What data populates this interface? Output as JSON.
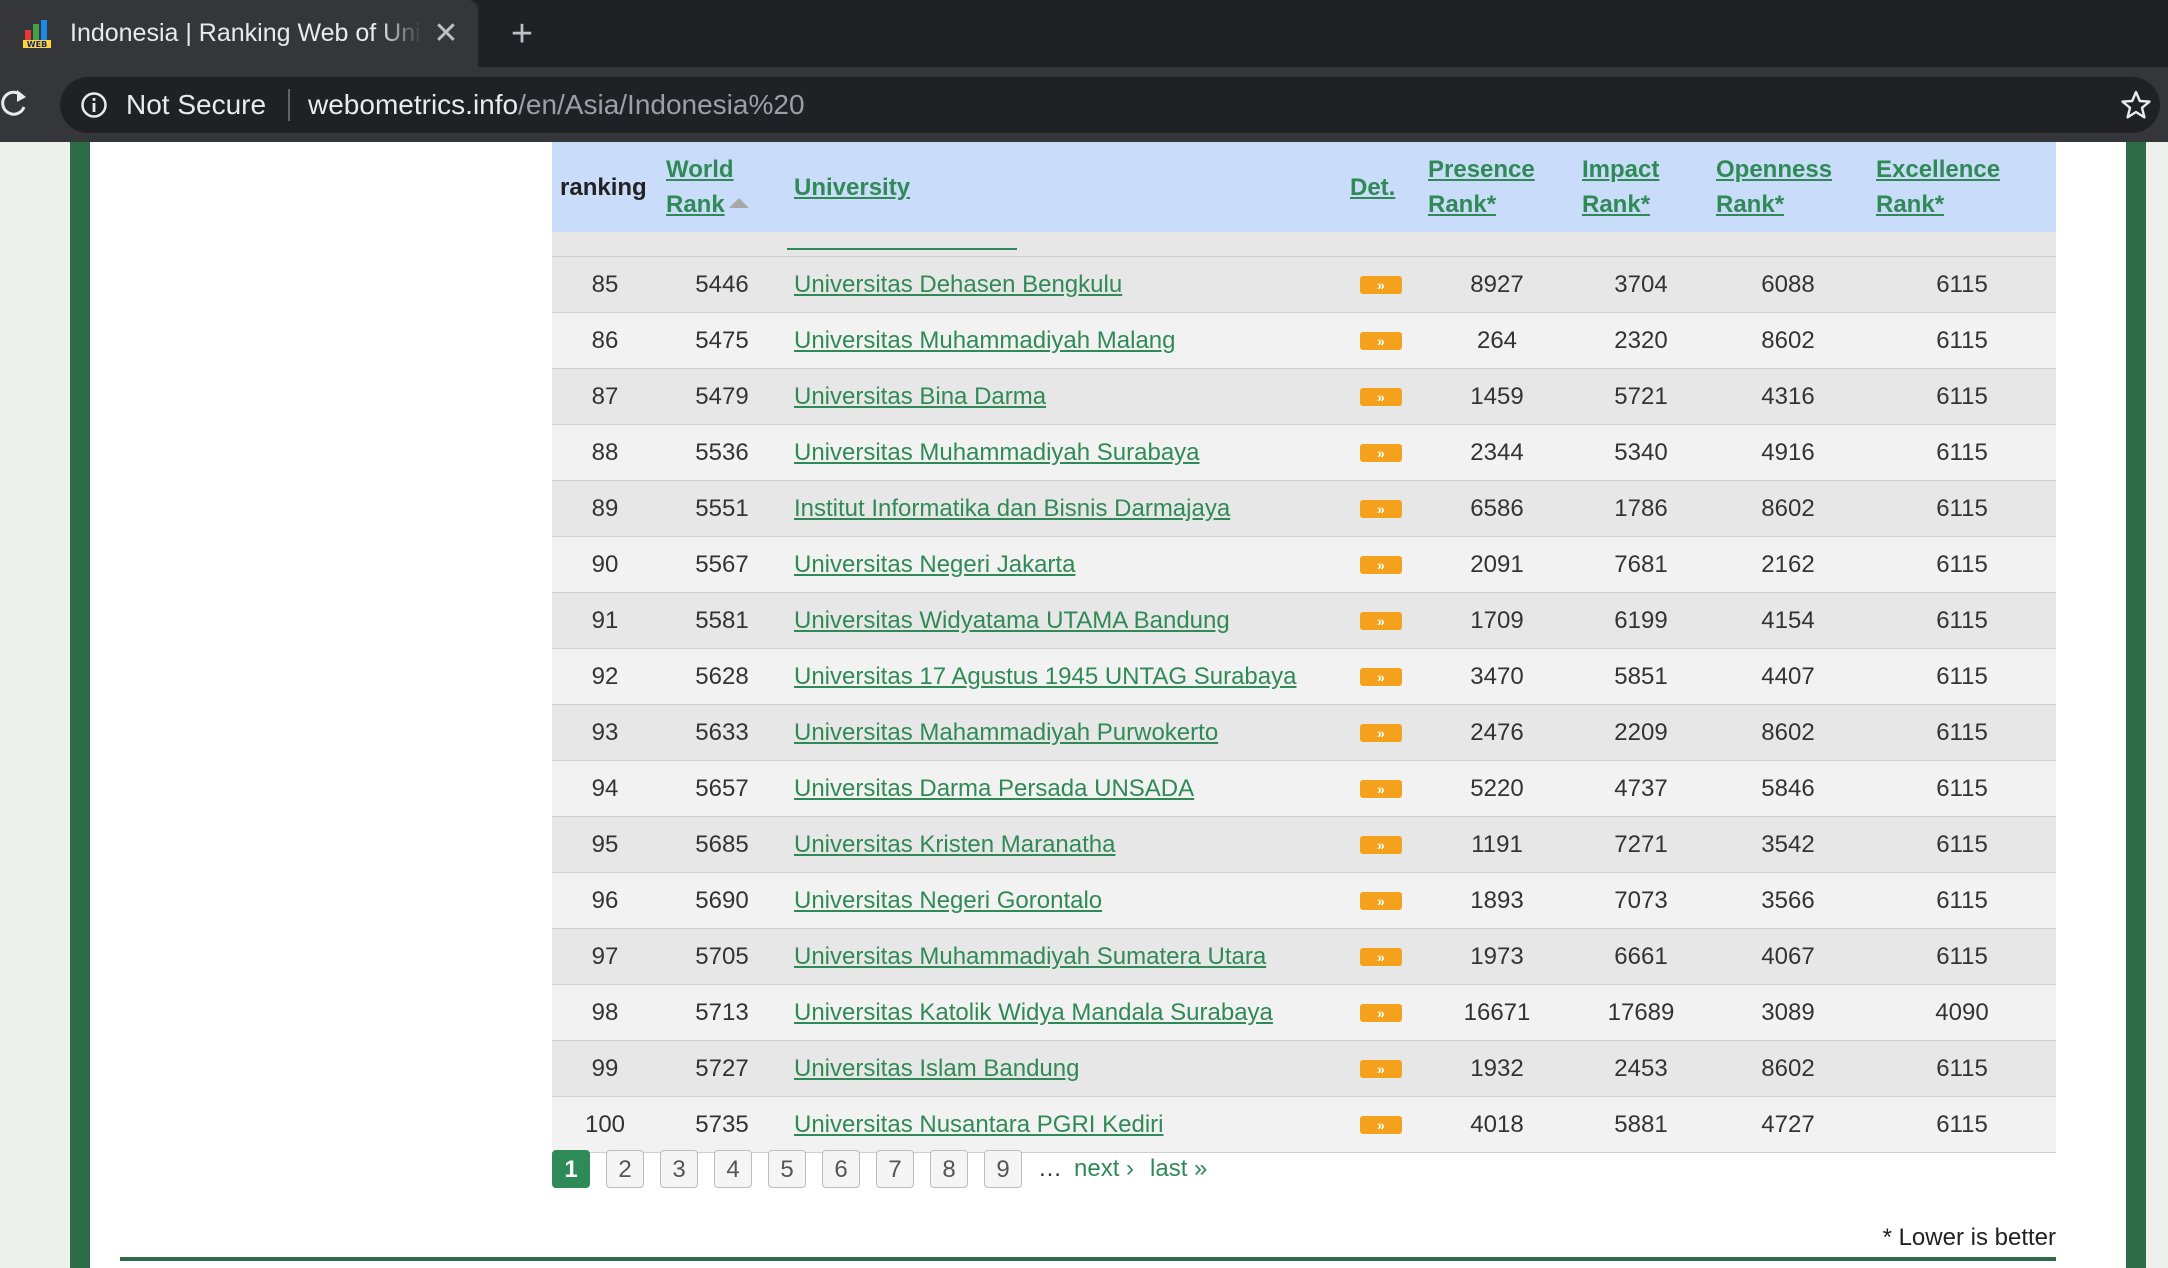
{
  "browser": {
    "tab_title": "Indonesia | Ranking Web of Universities",
    "close_glyph": "✕",
    "new_tab_glyph": "+",
    "security_label": "Not Secure",
    "url_host": "webometrics.info",
    "url_path": "/en/Asia/Indonesia%20"
  },
  "table": {
    "headers": {
      "ranking": "ranking",
      "world_rank_1": "World",
      "world_rank_2": "Rank",
      "university": "University",
      "det": "Det.",
      "presence_1": "Presence",
      "presence_2": "Rank*",
      "impact_1": "Impact",
      "impact_2": "Rank*",
      "openness_1": "Openness",
      "openness_2": "Rank*",
      "excellence_1": "Excellence",
      "excellence_2": "Rank*"
    },
    "det_glyph": "»",
    "rows": [
      {
        "ranking": "85",
        "world": "5446",
        "university": "Universitas Dehasen Bengkulu",
        "presence": "8927",
        "impact": "3704",
        "openness": "6088",
        "excellence": "6115"
      },
      {
        "ranking": "86",
        "world": "5475",
        "university": "Universitas Muhammadiyah Malang",
        "presence": "264",
        "impact": "2320",
        "openness": "8602",
        "excellence": "6115"
      },
      {
        "ranking": "87",
        "world": "5479",
        "university": "Universitas Bina Darma",
        "presence": "1459",
        "impact": "5721",
        "openness": "4316",
        "excellence": "6115"
      },
      {
        "ranking": "88",
        "world": "5536",
        "university": "Universitas Muhammadiyah Surabaya",
        "presence": "2344",
        "impact": "5340",
        "openness": "4916",
        "excellence": "6115"
      },
      {
        "ranking": "89",
        "world": "5551",
        "university": "Institut Informatika dan Bisnis Darmajaya",
        "presence": "6586",
        "impact": "1786",
        "openness": "8602",
        "excellence": "6115"
      },
      {
        "ranking": "90",
        "world": "5567",
        "university": "Universitas Negeri Jakarta",
        "presence": "2091",
        "impact": "7681",
        "openness": "2162",
        "excellence": "6115"
      },
      {
        "ranking": "91",
        "world": "5581",
        "university": "Universitas Widyatama UTAMA Bandung",
        "presence": "1709",
        "impact": "6199",
        "openness": "4154",
        "excellence": "6115"
      },
      {
        "ranking": "92",
        "world": "5628",
        "university": "Universitas 17 Agustus 1945 UNTAG Surabaya",
        "presence": "3470",
        "impact": "5851",
        "openness": "4407",
        "excellence": "6115"
      },
      {
        "ranking": "93",
        "world": "5633",
        "university": "Universitas Mahammadiyah Purwokerto",
        "presence": "2476",
        "impact": "2209",
        "openness": "8602",
        "excellence": "6115"
      },
      {
        "ranking": "94",
        "world": "5657",
        "university": "Universitas Darma Persada UNSADA",
        "presence": "5220",
        "impact": "4737",
        "openness": "5846",
        "excellence": "6115"
      },
      {
        "ranking": "95",
        "world": "5685",
        "university": "Universitas Kristen Maranatha",
        "presence": "1191",
        "impact": "7271",
        "openness": "3542",
        "excellence": "6115"
      },
      {
        "ranking": "96",
        "world": "5690",
        "university": "Universitas Negeri Gorontalo",
        "presence": "1893",
        "impact": "7073",
        "openness": "3566",
        "excellence": "6115"
      },
      {
        "ranking": "97",
        "world": "5705",
        "university": "Universitas Muhammadiyah Sumatera Utara",
        "presence": "1973",
        "impact": "6661",
        "openness": "4067",
        "excellence": "6115"
      },
      {
        "ranking": "98",
        "world": "5713",
        "university": "Universitas Katolik Widya Mandala Surabaya",
        "presence": "16671",
        "impact": "17689",
        "openness": "3089",
        "excellence": "4090"
      },
      {
        "ranking": "99",
        "world": "5727",
        "university": "Universitas Islam Bandung",
        "presence": "1932",
        "impact": "2453",
        "openness": "8602",
        "excellence": "6115"
      },
      {
        "ranking": "100",
        "world": "5735",
        "university": "Universitas Nusantara PGRI Kediri",
        "presence": "4018",
        "impact": "5881",
        "openness": "4727",
        "excellence": "6115"
      }
    ]
  },
  "pager": {
    "pages": [
      "1",
      "2",
      "3",
      "4",
      "5",
      "6",
      "7",
      "8",
      "9"
    ],
    "current": "1",
    "ellipsis": "…",
    "next": "next ›",
    "last": "last »"
  },
  "footnote": "* Lower is better",
  "colors": {
    "link_green": "#2f8a55",
    "frame_green": "#2e6b47",
    "header_blue": "#c9dcfa",
    "det_orange": "#f4a11d"
  }
}
